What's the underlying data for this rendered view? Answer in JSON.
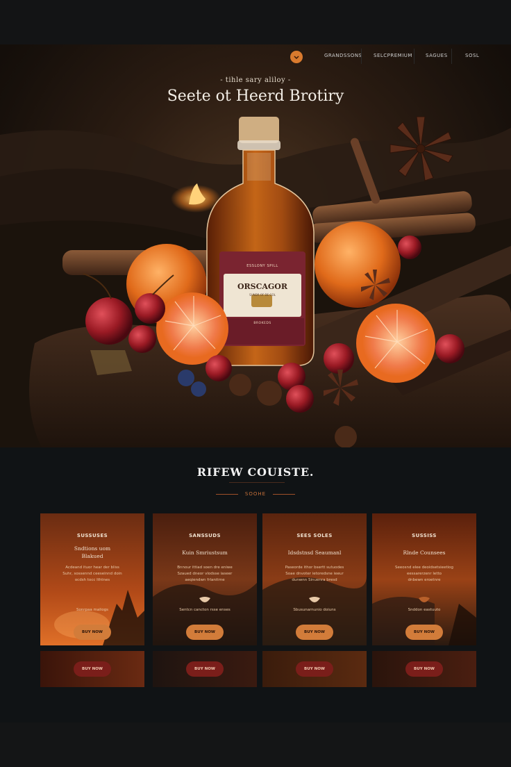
{
  "nav": {
    "items": [
      "GRANDSSONS",
      "SELCPREMIUM",
      "SAGUES",
      "SOSL"
    ]
  },
  "hero": {
    "eyebrow": "- tihle sary aliloy -",
    "title": "Seete ot Heerd Brotiry",
    "bottle_label": {
      "top": "ESSLONY SPILL",
      "name": "ORSCAGOR",
      "small": "SUNDR OF DE GOL",
      "bottom": "BROKEDS"
    }
  },
  "section": {
    "title": "RIFEW COUISTE.",
    "subtitle": "SOOHE"
  },
  "cards": [
    {
      "name": "SUSSUSES",
      "sub_lines": [
        "Sndtions uom",
        "Blakued"
      ],
      "desc": [
        "Acdeand ituor hear der bliss",
        "Suhr, sossennd ceeseinnd doin",
        "ocdsh tocc lthtnes"
      ],
      "note": "Sonrpaa maliogs",
      "button": "BUY NOW"
    },
    {
      "name": "SANSSUDS",
      "sub_lines": [
        "Kuin Smriustsum"
      ],
      "desc": [
        "Bnnour ittiad soen dre eniwe",
        "Szaued dneor vlodsse iaseer",
        "aeqiendwn frlanitrne"
      ],
      "note": "Sentcn cancton rsse enses",
      "button": "BUY NOW"
    },
    {
      "name": "SEES SOLES",
      "sub_lines": [
        "Idsdstnsd Seaumanl"
      ],
      "desc": [
        "Paseorde ithor bsertt sutuodes",
        "Soae dnvoter ietoredsne ieeur",
        "dunwnn Sinuenra bresd"
      ],
      "note": "Sbusunarnunio doiuns",
      "button": "BUY NOW"
    },
    {
      "name": "SUSSISS",
      "sub_lines": [
        "Rlnde Counsees"
      ],
      "desc": [
        "Seeosnd elee deoidsetsieetiog",
        "eessarerzenr letto",
        "dnbewn eroetnre"
      ],
      "note": "Snddon eastuuto",
      "button": "BUY NOW"
    }
  ],
  "strip": [
    {
      "button": "BUY NOW"
    },
    {
      "button": "BUY NOW"
    },
    {
      "button": "BUY NOW"
    },
    {
      "button": "BUY NOW"
    }
  ],
  "colors": {
    "accent": "#d27c3a",
    "dark_button": "#7a1e1a",
    "background": "#101315"
  }
}
